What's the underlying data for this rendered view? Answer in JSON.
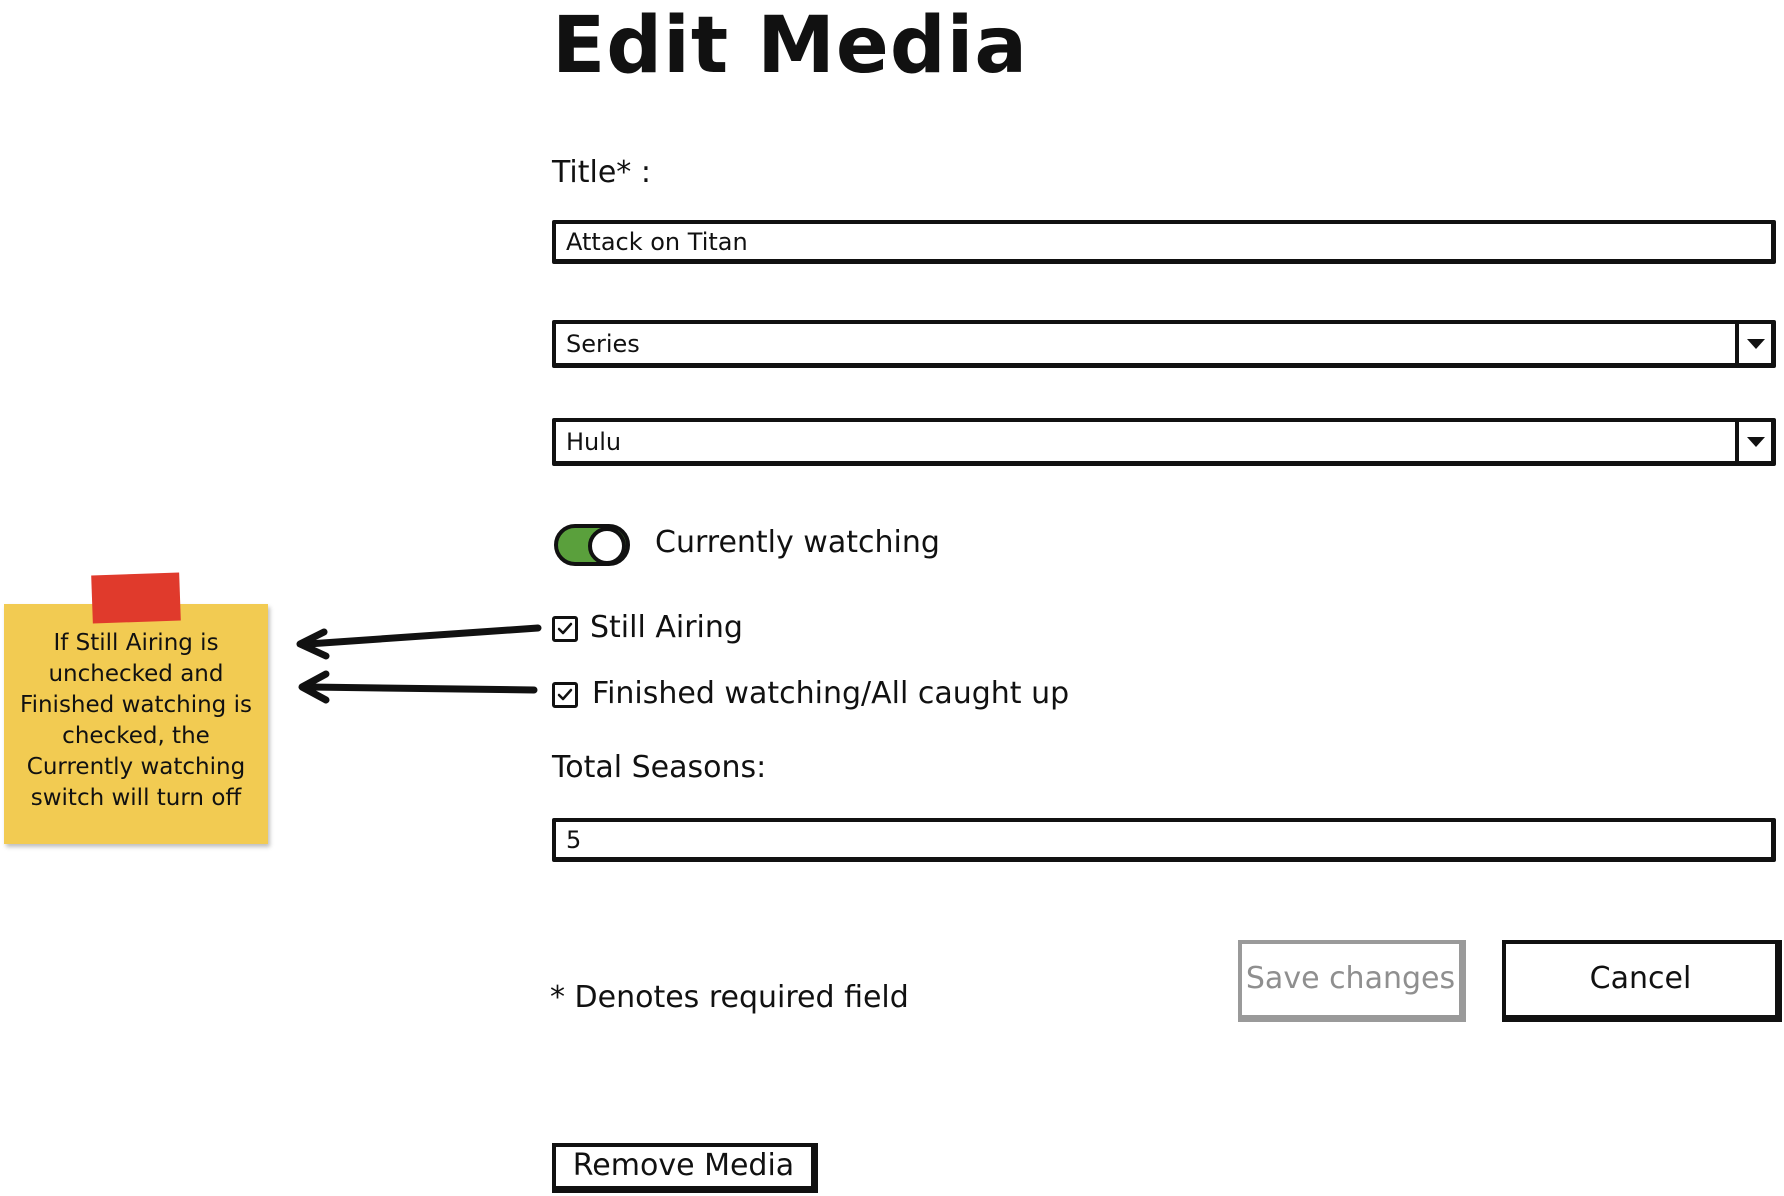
{
  "page": {
    "title": "Edit Media"
  },
  "form": {
    "title_label": "Title* :",
    "title_value": "Attack on Titan",
    "type_select": {
      "selected": "Series"
    },
    "service_select": {
      "selected": "Hulu"
    },
    "currently_watching": {
      "label": "Currently watching",
      "on": true
    },
    "still_airing": {
      "label": "Still Airing",
      "checked": true
    },
    "finished_watching": {
      "label": "Finished watching/All caught up",
      "checked": true
    },
    "total_seasons_label": "Total Seasons:",
    "total_seasons_value": "5"
  },
  "actions": {
    "save_label": "Save changes",
    "cancel_label": "Cancel",
    "remove_label": "Remove Media"
  },
  "footnote": "* Denotes required field",
  "annotation": {
    "note_text": "If Still Airing is unchecked and Finished watching is checked, the Currently watching switch will turn off"
  },
  "colors": {
    "toggle_on": "#5aa03c",
    "sticky_note": "#f2cb52",
    "sticky_tape": "#e03a2c",
    "disabled_text": "#8f8f8f"
  },
  "icons": {
    "checkbox": "check-icon",
    "dropdown": "chevron-down-icon",
    "arrow": "arrow-left-icon"
  }
}
